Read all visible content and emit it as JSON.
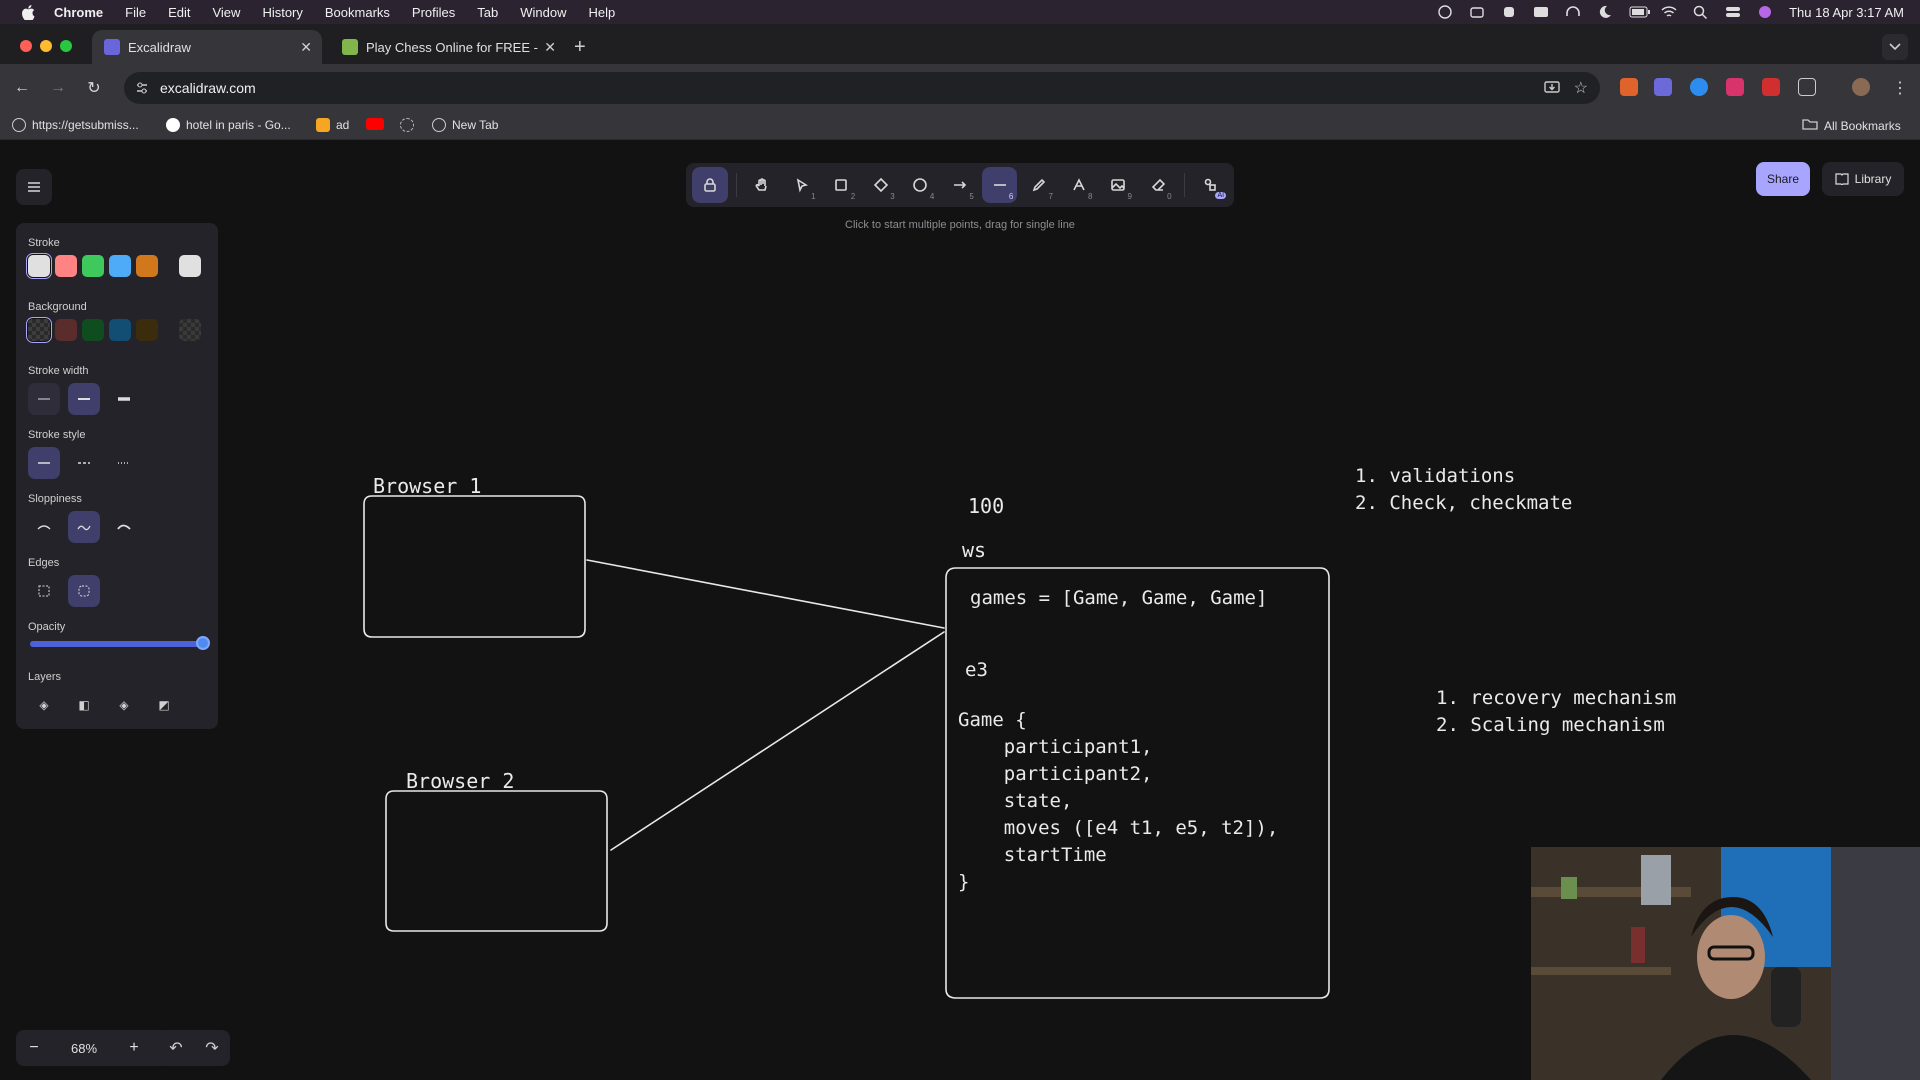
{
  "menubar": {
    "app": "Chrome",
    "items": [
      "File",
      "Edit",
      "View",
      "History",
      "Bookmarks",
      "Profiles",
      "Tab",
      "Window",
      "Help"
    ],
    "clock": "Thu 18 Apr  3:17 AM"
  },
  "tabs": [
    {
      "title": "Excalidraw",
      "active": true
    },
    {
      "title": "Play Chess Online for FREE -",
      "active": false
    }
  ],
  "address": {
    "url": "excalidraw.com"
  },
  "bookmarks": {
    "items": [
      "https://getsubmiss...",
      "hotel in paris - Go...",
      "ad",
      "",
      "",
      "New Tab"
    ],
    "all_label": "All Bookmarks"
  },
  "toolbar": {
    "keys": [
      "",
      "",
      "1",
      "2",
      "3",
      "4",
      "5",
      "6",
      "7",
      "8",
      "9",
      "0",
      ""
    ],
    "hint": "Click to start multiple points, drag for single line",
    "ai_badge": "AI"
  },
  "topright": {
    "share": "Share",
    "library": "Library"
  },
  "properties": {
    "stroke_label": "Stroke",
    "stroke_colors": [
      "#e0e0e0",
      "#ff8383",
      "#3ec95c",
      "#4dabf7",
      "#d2781c"
    ],
    "stroke_current": "#e0e0e0",
    "background_label": "Background",
    "background_colors": [
      "#2b2b2b",
      "#5b2c2c",
      "#0f4d1f",
      "#124d74",
      "#3b2c0c"
    ],
    "background_current": "#2b2b2b",
    "stroke_width_label": "Stroke width",
    "stroke_style_label": "Stroke style",
    "sloppiness_label": "Sloppiness",
    "edges_label": "Edges",
    "opacity_label": "Opacity",
    "opacity_value": 1.0,
    "layers_label": "Layers"
  },
  "zoom": {
    "value": "68%",
    "minus": "−",
    "plus": "+"
  },
  "canvas": {
    "browser1_label": "Browser 1",
    "browser2_label": "Browser 2",
    "count_label": "100",
    "ws_label": "ws",
    "games_line": "games = [Game, Game, Game]",
    "e3_label": "e3",
    "game_struct": "Game {\n    participant1,\n    participant2,\n    state,\n    moves ([e4 t1, e5, t2]),\n    startTime\n}",
    "notes_top": "1. validations\n2. Check, checkmate",
    "notes_bottom": "1. recovery mechanism\n2. Scaling mechanism"
  }
}
